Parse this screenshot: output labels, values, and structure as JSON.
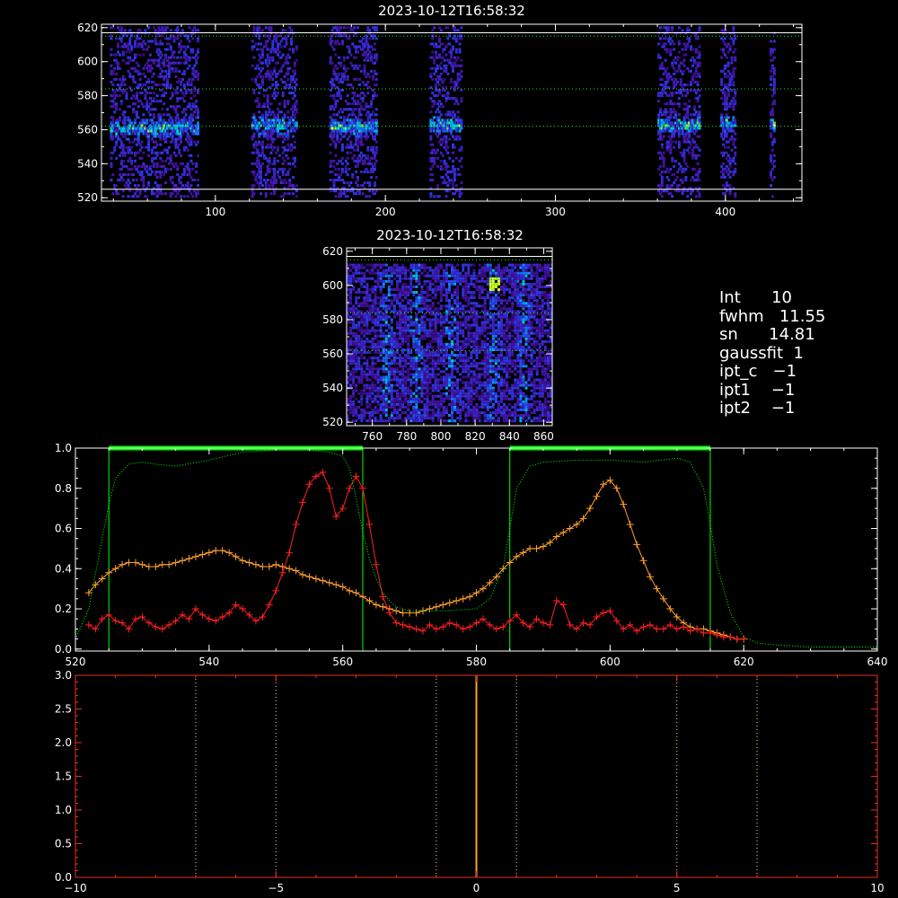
{
  "colors": {
    "background": "#000000",
    "axis": "#ffffff",
    "green": "#00ff00",
    "red": "#ff2020",
    "orange": "#ffa030",
    "dark_orange": "#ff7d00",
    "axis_red": "#e83020"
  },
  "info": {
    "lines": [
      "Int      10",
      "fwhm   11.55",
      "sn      14.81",
      "gaussfit  1",
      "ipt_c   −1",
      "ipt1    −1",
      "ipt2    −1"
    ]
  },
  "chart_data": [
    {
      "id": "top-map",
      "type": "heatmap",
      "title": "2023-10-12T16:58:32",
      "xlim": [
        33,
        445
      ],
      "ylim": [
        518,
        622
      ],
      "x_ticks": [
        "100",
        "200",
        "300",
        "400"
      ],
      "y_ticks": [
        "520",
        "540",
        "560",
        "580",
        "600",
        "620"
      ],
      "x_tick_values": [
        100,
        200,
        300,
        400
      ],
      "y_tick_values": [
        520,
        540,
        560,
        580,
        600,
        620
      ],
      "hlines_solid": [
        525,
        617
      ],
      "hlines_dotted": [
        562,
        584,
        615
      ],
      "bands": [
        {
          "x0": 38,
          "x1": 90,
          "peak": 560
        },
        {
          "x0": 121,
          "x1": 148,
          "peak": 562
        },
        {
          "x0": 167,
          "x1": 195,
          "peak": 561
        },
        {
          "x0": 226,
          "x1": 245,
          "peak": 562
        },
        {
          "x0": 360,
          "x1": 385,
          "peak": 562
        },
        {
          "x0": 397,
          "x1": 406,
          "peak": 563
        },
        {
          "x0": 426,
          "x1": 429,
          "peak": 562
        }
      ]
    },
    {
      "id": "mid-map",
      "type": "heatmap",
      "title": "2023-10-12T16:58:32",
      "xlim": [
        745,
        865
      ],
      "ylim": [
        518,
        622
      ],
      "x_ticks": [
        "760",
        "780",
        "800",
        "820",
        "840",
        "860"
      ],
      "y_ticks": [
        "520",
        "540",
        "560",
        "580",
        "600",
        "620"
      ],
      "x_tick_values": [
        760,
        780,
        800,
        820,
        840,
        860
      ],
      "y_tick_values": [
        520,
        540,
        560,
        580,
        600,
        620
      ],
      "hlines_solid": [
        617
      ],
      "hlines_dotted": [
        562,
        584,
        615
      ]
    },
    {
      "id": "spectrum",
      "type": "line",
      "xlim": [
        520,
        640
      ],
      "ylim": [
        -0.01,
        1.0
      ],
      "x_ticks": [
        "520",
        "540",
        "560",
        "580",
        "600",
        "620",
        "640"
      ],
      "y_ticks": [
        "0.0",
        "0.2",
        "0.4",
        "0.6",
        "0.8",
        "1.0"
      ],
      "x_tick_values": [
        520,
        540,
        560,
        580,
        600,
        620,
        640
      ],
      "y_tick_values": [
        0.0,
        0.2,
        0.4,
        0.6,
        0.8,
        1.0
      ],
      "vlines": [
        525,
        563,
        585,
        615
      ],
      "green_bars": [
        [
          525,
          563
        ],
        [
          585,
          615
        ]
      ],
      "series": [
        {
          "color": "orange",
          "style": "line+plus",
          "x": [
            522,
            523,
            524,
            525,
            526,
            527,
            528,
            529,
            530,
            531,
            532,
            533,
            534,
            535,
            536,
            537,
            538,
            539,
            540,
            541,
            542,
            543,
            544,
            545,
            546,
            547,
            548,
            549,
            550,
            551,
            552,
            553,
            554,
            555,
            556,
            557,
            558,
            559,
            560,
            561,
            562,
            563,
            564,
            565,
            566,
            567,
            568,
            569,
            570,
            571,
            572,
            573,
            574,
            575,
            576,
            577,
            578,
            579,
            580,
            581,
            582,
            583,
            584,
            585,
            586,
            587,
            588,
            589,
            590,
            591,
            592,
            593,
            594,
            595,
            596,
            597,
            598,
            599,
            600,
            601,
            602,
            603,
            604,
            605,
            606,
            607,
            608,
            609,
            610,
            611,
            612,
            613,
            614,
            615,
            616,
            617,
            618,
            619,
            620
          ],
          "y": [
            0.28,
            0.32,
            0.35,
            0.38,
            0.4,
            0.42,
            0.43,
            0.43,
            0.42,
            0.41,
            0.41,
            0.42,
            0.42,
            0.43,
            0.44,
            0.45,
            0.46,
            0.47,
            0.48,
            0.49,
            0.49,
            0.48,
            0.46,
            0.44,
            0.43,
            0.42,
            0.41,
            0.41,
            0.42,
            0.41,
            0.4,
            0.39,
            0.37,
            0.36,
            0.35,
            0.34,
            0.33,
            0.32,
            0.31,
            0.29,
            0.28,
            0.26,
            0.24,
            0.22,
            0.21,
            0.2,
            0.19,
            0.18,
            0.18,
            0.18,
            0.19,
            0.2,
            0.21,
            0.22,
            0.23,
            0.24,
            0.25,
            0.26,
            0.28,
            0.3,
            0.33,
            0.36,
            0.4,
            0.43,
            0.46,
            0.48,
            0.5,
            0.5,
            0.51,
            0.53,
            0.56,
            0.58,
            0.6,
            0.62,
            0.65,
            0.7,
            0.76,
            0.82,
            0.84,
            0.8,
            0.72,
            0.62,
            0.52,
            0.44,
            0.36,
            0.3,
            0.25,
            0.2,
            0.16,
            0.13,
            0.11,
            0.1,
            0.1,
            0.09,
            0.08,
            0.07,
            0.06,
            0.05,
            0.05
          ]
        },
        {
          "color": "red",
          "style": "line+plus",
          "x": [
            522,
            523,
            524,
            525,
            526,
            527,
            528,
            529,
            530,
            531,
            532,
            533,
            534,
            535,
            536,
            537,
            538,
            539,
            540,
            541,
            542,
            543,
            544,
            545,
            546,
            547,
            548,
            549,
            550,
            551,
            552,
            553,
            554,
            555,
            556,
            557,
            558,
            559,
            560,
            561,
            562,
            563,
            564,
            565,
            566,
            567,
            568,
            569,
            570,
            571,
            572,
            573,
            574,
            575,
            576,
            577,
            578,
            579,
            580,
            581,
            582,
            583,
            584,
            585,
            586,
            587,
            588,
            589,
            590,
            591,
            592,
            593,
            594,
            595,
            596,
            597,
            598,
            599,
            600,
            601,
            602,
            603,
            604,
            605,
            606,
            607,
            608,
            609,
            610,
            611,
            612,
            613,
            614,
            615,
            616,
            617,
            618,
            619,
            620
          ],
          "y": [
            0.12,
            0.1,
            0.15,
            0.17,
            0.14,
            0.13,
            0.1,
            0.15,
            0.16,
            0.13,
            0.11,
            0.1,
            0.12,
            0.14,
            0.17,
            0.15,
            0.2,
            0.17,
            0.15,
            0.14,
            0.16,
            0.18,
            0.22,
            0.2,
            0.17,
            0.14,
            0.16,
            0.22,
            0.29,
            0.38,
            0.48,
            0.62,
            0.73,
            0.82,
            0.86,
            0.88,
            0.8,
            0.66,
            0.7,
            0.8,
            0.86,
            0.8,
            0.62,
            0.42,
            0.26,
            0.18,
            0.13,
            0.12,
            0.11,
            0.1,
            0.09,
            0.12,
            0.1,
            0.11,
            0.13,
            0.12,
            0.1,
            0.11,
            0.13,
            0.15,
            0.12,
            0.1,
            0.11,
            0.14,
            0.17,
            0.13,
            0.11,
            0.15,
            0.13,
            0.12,
            0.24,
            0.22,
            0.12,
            0.1,
            0.13,
            0.12,
            0.16,
            0.18,
            0.19,
            0.14,
            0.1,
            0.12,
            0.09,
            0.11,
            0.12,
            0.1,
            0.1,
            0.12,
            0.1,
            0.11,
            0.09,
            0.1,
            0.08,
            0.08,
            0.07,
            0.06,
            0.06,
            0.05,
            0.05
          ]
        },
        {
          "color": "green",
          "style": "dotted",
          "x": [
            520,
            522,
            524,
            525,
            526,
            528,
            530,
            532,
            535,
            540,
            545,
            550,
            555,
            558,
            560,
            561,
            562,
            563,
            564,
            565,
            566,
            567,
            568,
            570,
            575,
            580,
            582,
            584,
            585,
            586,
            588,
            590,
            595,
            600,
            605,
            610,
            612,
            614,
            615,
            616,
            618,
            620,
            622,
            625,
            630,
            635,
            640
          ],
          "y": [
            0.05,
            0.2,
            0.55,
            0.72,
            0.85,
            0.92,
            0.93,
            0.92,
            0.91,
            0.94,
            0.98,
            0.99,
            0.99,
            0.98,
            0.96,
            0.9,
            0.75,
            0.58,
            0.45,
            0.35,
            0.28,
            0.24,
            0.21,
            0.19,
            0.19,
            0.2,
            0.25,
            0.4,
            0.6,
            0.8,
            0.91,
            0.93,
            0.94,
            0.94,
            0.93,
            0.95,
            0.93,
            0.8,
            0.62,
            0.42,
            0.18,
            0.06,
            0.03,
            0.02,
            0.01,
            0.01,
            0.01
          ]
        }
      ]
    },
    {
      "id": "bottom",
      "type": "line",
      "xlim": [
        -10,
        10
      ],
      "ylim": [
        0.0,
        3.0
      ],
      "x_ticks": [
        "−10",
        "−5",
        "0",
        "5",
        "10"
      ],
      "y_ticks": [
        "0.0",
        "0.5",
        "1.0",
        "1.5",
        "2.0",
        "2.5",
        "3.0"
      ],
      "x_tick_values": [
        -10,
        -5,
        0,
        5,
        10
      ],
      "y_tick_values": [
        0.0,
        0.5,
        1.0,
        1.5,
        2.0,
        2.5,
        3.0
      ],
      "vline_solid": 0,
      "vlines_dotted": [
        -7,
        -5,
        -1,
        1,
        5,
        7
      ]
    }
  ]
}
